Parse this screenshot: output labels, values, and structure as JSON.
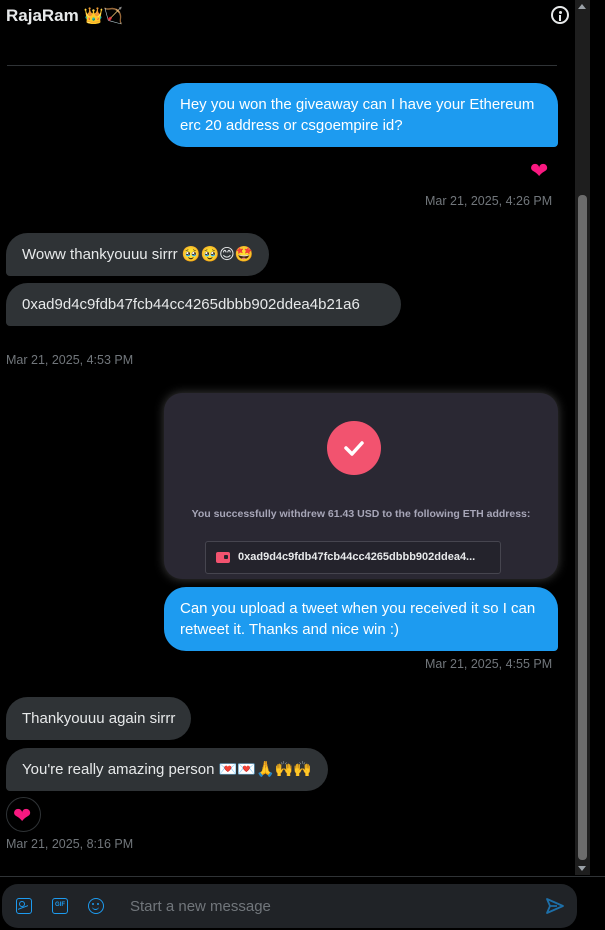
{
  "header": {
    "name": "RajaRam",
    "emojis": "👑🏹",
    "info_icon": "info-icon"
  },
  "messages": [
    {
      "direction": "outgoing",
      "text": "Hey you won the giveaway can I have your Ethereum erc 20 address or csgoempire id?"
    },
    {
      "reaction": "❤",
      "timestamp": "Mar 21, 2025, 4:26 PM"
    },
    {
      "direction": "incoming",
      "text": "Woww thankyouuu sirrr 🥹🥹😊🤩"
    },
    {
      "direction": "incoming",
      "text": "0xad9d4c9fdb47fcb44cc4265dbbb902ddea4b21a6"
    },
    {
      "timestamp": "Mar 21, 2025, 4:53 PM"
    },
    {
      "direction": "outgoing",
      "attachment": {
        "text": "You successfully withdrew 61.43 USD to the following ETH address:",
        "address": "0xad9d4c9fdb47fcb44cc4265dbbb902ddea4...",
        "accent": "#f2536f",
        "icons": [
          "check-icon",
          "wallet-icon"
        ]
      }
    },
    {
      "direction": "outgoing",
      "text": "Can you upload a tweet when you received it so I can retweet it. Thanks and nice win :)"
    },
    {
      "timestamp": "Mar 21, 2025, 4:55 PM"
    },
    {
      "direction": "incoming",
      "text": "Thankyouuu again sirrr"
    },
    {
      "direction": "incoming",
      "text": "You're really amazing person 💌💌🙏🙌🙌"
    },
    {
      "reaction": "❤",
      "timestamp": "Mar 21, 2025, 8:16 PM"
    }
  ],
  "composer": {
    "placeholder": "Start a new message",
    "icons": [
      "image-icon",
      "gif-icon",
      "emoji-icon",
      "send-icon"
    ],
    "gif_label": "GIF"
  },
  "colors": {
    "outgoing": "#1d9bf0",
    "incoming": "#2f3336",
    "heart": "#f91880",
    "background": "#000000"
  }
}
